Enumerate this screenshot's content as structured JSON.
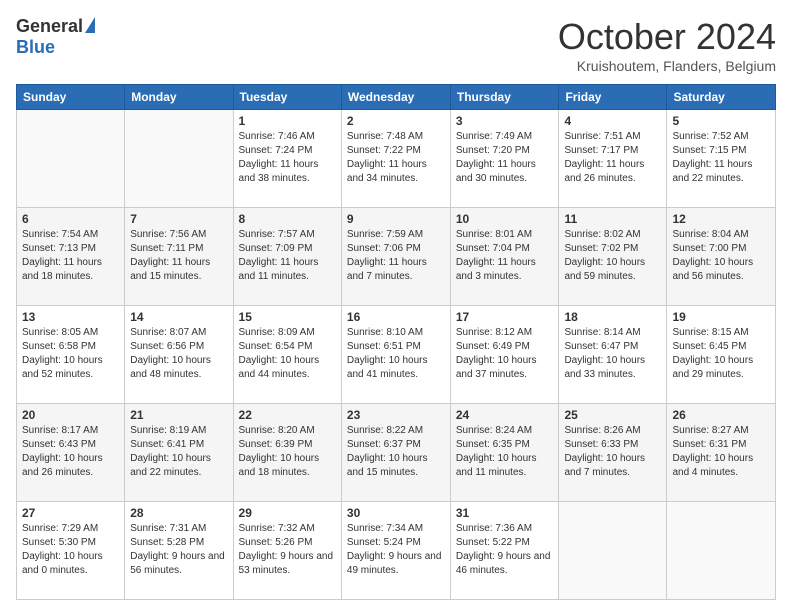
{
  "header": {
    "logo_general": "General",
    "logo_blue": "Blue",
    "month_title": "October 2024",
    "subtitle": "Kruishoutem, Flanders, Belgium"
  },
  "days_of_week": [
    "Sunday",
    "Monday",
    "Tuesday",
    "Wednesday",
    "Thursday",
    "Friday",
    "Saturday"
  ],
  "weeks": [
    [
      {
        "day": "",
        "sunrise": "",
        "sunset": "",
        "daylight": ""
      },
      {
        "day": "",
        "sunrise": "",
        "sunset": "",
        "daylight": ""
      },
      {
        "day": "1",
        "sunrise": "Sunrise: 7:46 AM",
        "sunset": "Sunset: 7:24 PM",
        "daylight": "Daylight: 11 hours and 38 minutes."
      },
      {
        "day": "2",
        "sunrise": "Sunrise: 7:48 AM",
        "sunset": "Sunset: 7:22 PM",
        "daylight": "Daylight: 11 hours and 34 minutes."
      },
      {
        "day": "3",
        "sunrise": "Sunrise: 7:49 AM",
        "sunset": "Sunset: 7:20 PM",
        "daylight": "Daylight: 11 hours and 30 minutes."
      },
      {
        "day": "4",
        "sunrise": "Sunrise: 7:51 AM",
        "sunset": "Sunset: 7:17 PM",
        "daylight": "Daylight: 11 hours and 26 minutes."
      },
      {
        "day": "5",
        "sunrise": "Sunrise: 7:52 AM",
        "sunset": "Sunset: 7:15 PM",
        "daylight": "Daylight: 11 hours and 22 minutes."
      }
    ],
    [
      {
        "day": "6",
        "sunrise": "Sunrise: 7:54 AM",
        "sunset": "Sunset: 7:13 PM",
        "daylight": "Daylight: 11 hours and 18 minutes."
      },
      {
        "day": "7",
        "sunrise": "Sunrise: 7:56 AM",
        "sunset": "Sunset: 7:11 PM",
        "daylight": "Daylight: 11 hours and 15 minutes."
      },
      {
        "day": "8",
        "sunrise": "Sunrise: 7:57 AM",
        "sunset": "Sunset: 7:09 PM",
        "daylight": "Daylight: 11 hours and 11 minutes."
      },
      {
        "day": "9",
        "sunrise": "Sunrise: 7:59 AM",
        "sunset": "Sunset: 7:06 PM",
        "daylight": "Daylight: 11 hours and 7 minutes."
      },
      {
        "day": "10",
        "sunrise": "Sunrise: 8:01 AM",
        "sunset": "Sunset: 7:04 PM",
        "daylight": "Daylight: 11 hours and 3 minutes."
      },
      {
        "day": "11",
        "sunrise": "Sunrise: 8:02 AM",
        "sunset": "Sunset: 7:02 PM",
        "daylight": "Daylight: 10 hours and 59 minutes."
      },
      {
        "day": "12",
        "sunrise": "Sunrise: 8:04 AM",
        "sunset": "Sunset: 7:00 PM",
        "daylight": "Daylight: 10 hours and 56 minutes."
      }
    ],
    [
      {
        "day": "13",
        "sunrise": "Sunrise: 8:05 AM",
        "sunset": "Sunset: 6:58 PM",
        "daylight": "Daylight: 10 hours and 52 minutes."
      },
      {
        "day": "14",
        "sunrise": "Sunrise: 8:07 AM",
        "sunset": "Sunset: 6:56 PM",
        "daylight": "Daylight: 10 hours and 48 minutes."
      },
      {
        "day": "15",
        "sunrise": "Sunrise: 8:09 AM",
        "sunset": "Sunset: 6:54 PM",
        "daylight": "Daylight: 10 hours and 44 minutes."
      },
      {
        "day": "16",
        "sunrise": "Sunrise: 8:10 AM",
        "sunset": "Sunset: 6:51 PM",
        "daylight": "Daylight: 10 hours and 41 minutes."
      },
      {
        "day": "17",
        "sunrise": "Sunrise: 8:12 AM",
        "sunset": "Sunset: 6:49 PM",
        "daylight": "Daylight: 10 hours and 37 minutes."
      },
      {
        "day": "18",
        "sunrise": "Sunrise: 8:14 AM",
        "sunset": "Sunset: 6:47 PM",
        "daylight": "Daylight: 10 hours and 33 minutes."
      },
      {
        "day": "19",
        "sunrise": "Sunrise: 8:15 AM",
        "sunset": "Sunset: 6:45 PM",
        "daylight": "Daylight: 10 hours and 29 minutes."
      }
    ],
    [
      {
        "day": "20",
        "sunrise": "Sunrise: 8:17 AM",
        "sunset": "Sunset: 6:43 PM",
        "daylight": "Daylight: 10 hours and 26 minutes."
      },
      {
        "day": "21",
        "sunrise": "Sunrise: 8:19 AM",
        "sunset": "Sunset: 6:41 PM",
        "daylight": "Daylight: 10 hours and 22 minutes."
      },
      {
        "day": "22",
        "sunrise": "Sunrise: 8:20 AM",
        "sunset": "Sunset: 6:39 PM",
        "daylight": "Daylight: 10 hours and 18 minutes."
      },
      {
        "day": "23",
        "sunrise": "Sunrise: 8:22 AM",
        "sunset": "Sunset: 6:37 PM",
        "daylight": "Daylight: 10 hours and 15 minutes."
      },
      {
        "day": "24",
        "sunrise": "Sunrise: 8:24 AM",
        "sunset": "Sunset: 6:35 PM",
        "daylight": "Daylight: 10 hours and 11 minutes."
      },
      {
        "day": "25",
        "sunrise": "Sunrise: 8:26 AM",
        "sunset": "Sunset: 6:33 PM",
        "daylight": "Daylight: 10 hours and 7 minutes."
      },
      {
        "day": "26",
        "sunrise": "Sunrise: 8:27 AM",
        "sunset": "Sunset: 6:31 PM",
        "daylight": "Daylight: 10 hours and 4 minutes."
      }
    ],
    [
      {
        "day": "27",
        "sunrise": "Sunrise: 7:29 AM",
        "sunset": "Sunset: 5:30 PM",
        "daylight": "Daylight: 10 hours and 0 minutes."
      },
      {
        "day": "28",
        "sunrise": "Sunrise: 7:31 AM",
        "sunset": "Sunset: 5:28 PM",
        "daylight": "Daylight: 9 hours and 56 minutes."
      },
      {
        "day": "29",
        "sunrise": "Sunrise: 7:32 AM",
        "sunset": "Sunset: 5:26 PM",
        "daylight": "Daylight: 9 hours and 53 minutes."
      },
      {
        "day": "30",
        "sunrise": "Sunrise: 7:34 AM",
        "sunset": "Sunset: 5:24 PM",
        "daylight": "Daylight: 9 hours and 49 minutes."
      },
      {
        "day": "31",
        "sunrise": "Sunrise: 7:36 AM",
        "sunset": "Sunset: 5:22 PM",
        "daylight": "Daylight: 9 hours and 46 minutes."
      },
      {
        "day": "",
        "sunrise": "",
        "sunset": "",
        "daylight": ""
      },
      {
        "day": "",
        "sunrise": "",
        "sunset": "",
        "daylight": ""
      }
    ]
  ]
}
